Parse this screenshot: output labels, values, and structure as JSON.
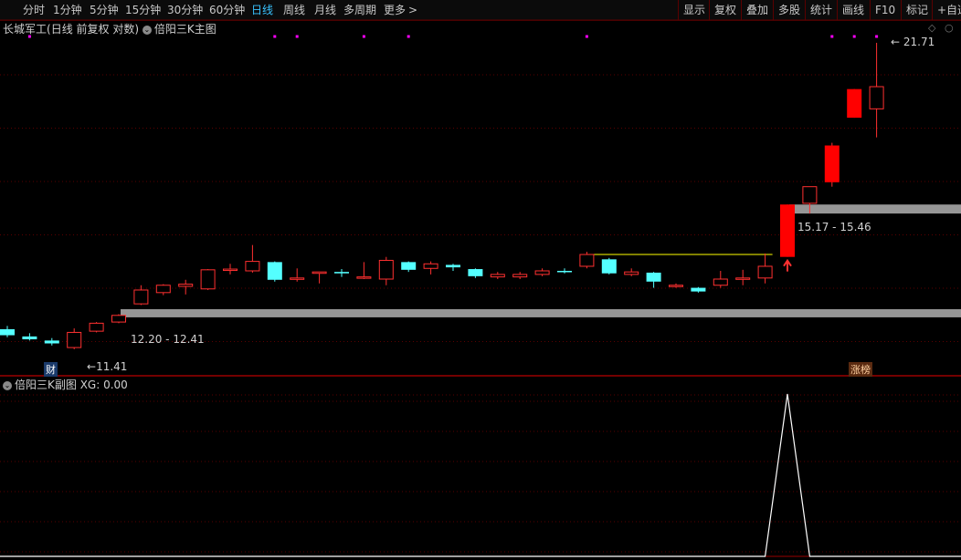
{
  "toolbar": {
    "periods": [
      "分时",
      "1分钟",
      "5分钟",
      "15分钟",
      "30分钟",
      "60分钟",
      "日线",
      "周线",
      "月线",
      "多周期",
      "更多"
    ],
    "active_period": "日线",
    "more_arrow": ">",
    "tools": [
      "显示",
      "复权",
      "叠加",
      "多股",
      "统计",
      "画线",
      "F10",
      "标记",
      "+自选"
    ]
  },
  "main_panel": {
    "stock_name": "长城军工",
    "params": "(日线 前复权 对数)",
    "indicator_name": "倍阳三K主图",
    "range_low_label": "12.20 - 12.41",
    "range_high_label": "15.17 - 15.46",
    "high_price_label": "21.71",
    "low_price_label": "11.41",
    "badge_cai": "财",
    "badge_zhangting": "涨榜"
  },
  "sub_panel": {
    "indicator_name": "倍阳三K副图",
    "xg_label": "XG: 0.00"
  },
  "colors": {
    "up": "#ff3030",
    "up_strong": "#ff0000",
    "down": "#54ffff",
    "grid": "#5a0000",
    "band": "#969696",
    "marker": "#ff00ff",
    "line": "#ffff00",
    "text": "#c8c8c8",
    "active_period": "#39c3ff"
  },
  "chart_data": {
    "type": "candlestick",
    "scale": "log",
    "candles": [
      {
        "o": 11.9,
        "h": 11.98,
        "l": 11.7,
        "c": 11.75
      },
      {
        "o": 11.72,
        "h": 11.8,
        "l": 11.62,
        "c": 11.65
      },
      {
        "o": 11.62,
        "h": 11.68,
        "l": 11.5,
        "c": 11.55
      },
      {
        "o": 11.45,
        "h": 11.92,
        "l": 11.41,
        "c": 11.82
      },
      {
        "o": 11.85,
        "h": 12.08,
        "l": 11.82,
        "c": 12.05
      },
      {
        "o": 12.08,
        "h": 12.28,
        "l": 12.05,
        "c": 12.25
      },
      {
        "o": 12.55,
        "h": 13.05,
        "l": 12.52,
        "c": 12.92
      },
      {
        "o": 12.85,
        "h": 13.08,
        "l": 12.78,
        "c": 13.05
      },
      {
        "o": 13.02,
        "h": 13.2,
        "l": 12.8,
        "c": 13.08
      },
      {
        "o": 12.95,
        "h": 13.5,
        "l": 12.92,
        "c": 13.48
      },
      {
        "o": 13.5,
        "h": 13.65,
        "l": 13.35,
        "c": 13.5
      },
      {
        "o": 13.45,
        "h": 14.2,
        "l": 13.4,
        "c": 13.72
      },
      {
        "o": 13.7,
        "h": 13.72,
        "l": 13.15,
        "c": 13.2
      },
      {
        "o": 13.22,
        "h": 13.52,
        "l": 13.15,
        "c": 13.25
      },
      {
        "o": 13.38,
        "h": 13.4,
        "l": 13.1,
        "c": 13.42
      },
      {
        "o": 13.42,
        "h": 13.5,
        "l": 13.28,
        "c": 13.38
      },
      {
        "o": 13.25,
        "h": 13.7,
        "l": 13.22,
        "c": 13.28
      },
      {
        "o": 13.22,
        "h": 13.85,
        "l": 13.05,
        "c": 13.75
      },
      {
        "o": 13.7,
        "h": 13.72,
        "l": 13.42,
        "c": 13.48
      },
      {
        "o": 13.52,
        "h": 13.72,
        "l": 13.35,
        "c": 13.65
      },
      {
        "o": 13.62,
        "h": 13.65,
        "l": 13.45,
        "c": 13.55
      },
      {
        "o": 13.5,
        "h": 13.52,
        "l": 13.25,
        "c": 13.3
      },
      {
        "o": 13.28,
        "h": 13.42,
        "l": 13.22,
        "c": 13.35
      },
      {
        "o": 13.28,
        "h": 13.42,
        "l": 13.22,
        "c": 13.35
      },
      {
        "o": 13.35,
        "h": 13.52,
        "l": 13.3,
        "c": 13.45
      },
      {
        "o": 13.45,
        "h": 13.52,
        "l": 13.38,
        "c": 13.42
      },
      {
        "o": 13.58,
        "h": 14.0,
        "l": 13.52,
        "c": 13.92
      },
      {
        "o": 13.78,
        "h": 13.82,
        "l": 13.35,
        "c": 13.38
      },
      {
        "o": 13.35,
        "h": 13.52,
        "l": 13.3,
        "c": 13.42
      },
      {
        "o": 13.4,
        "h": 13.42,
        "l": 12.98,
        "c": 13.15
      },
      {
        "o": 13.05,
        "h": 13.1,
        "l": 12.98,
        "c": 13.05
      },
      {
        "o": 12.98,
        "h": 13.0,
        "l": 12.85,
        "c": 12.88
      },
      {
        "o": 13.05,
        "h": 13.45,
        "l": 12.98,
        "c": 13.22
      },
      {
        "o": 13.25,
        "h": 13.48,
        "l": 13.05,
        "c": 13.25
      },
      {
        "o": 13.25,
        "h": 13.95,
        "l": 13.1,
        "c": 13.58
      },
      {
        "o": 13.85,
        "h": 15.46,
        "l": 13.85,
        "c": 15.46
      },
      {
        "o": 15.5,
        "h": 16.05,
        "l": 15.17,
        "c": 16.05
      },
      {
        "o": 16.2,
        "h": 17.6,
        "l": 16.05,
        "c": 17.5
      },
      {
        "o": 18.55,
        "h": 19.7,
        "l": 18.55,
        "c": 19.7
      },
      {
        "o": 18.9,
        "h": 21.71,
        "l": 17.8,
        "c": 19.8
      }
    ],
    "markers_top": [
      1,
      12,
      13,
      16,
      18,
      26,
      37,
      38,
      39
    ],
    "signal_bar": 35,
    "band_low": {
      "from": 12.2,
      "to": 12.41,
      "start": 5
    },
    "band_high": {
      "from": 15.17,
      "to": 15.46,
      "start": 35
    },
    "yellow_line": {
      "value": 13.92,
      "start": 26,
      "end": 34
    },
    "xg": {
      "name": "XG",
      "values_nonzero_at": 35,
      "value_at_signal": 1,
      "current": 0.0
    }
  }
}
